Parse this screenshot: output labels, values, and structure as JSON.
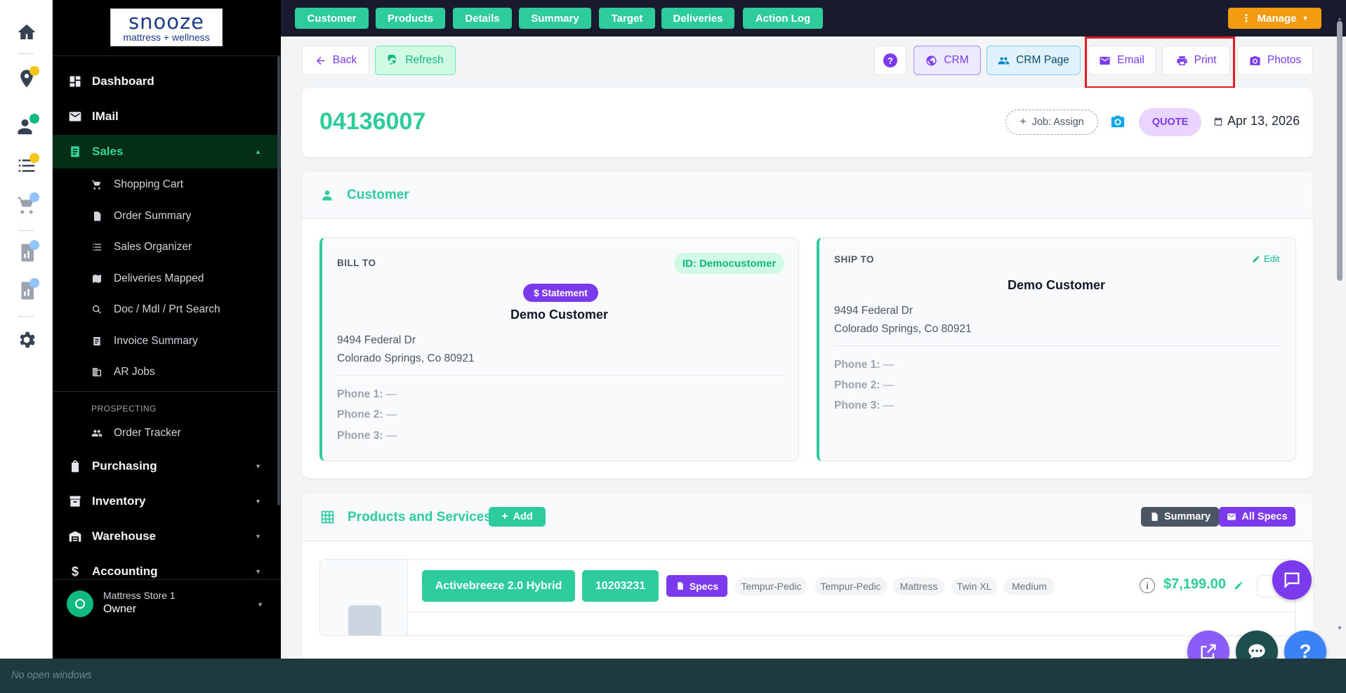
{
  "brand": {
    "logo_main": "snooze",
    "logo_sub": "mattress + wellness"
  },
  "sidebar": {
    "items": [
      {
        "label": "Dashboard"
      },
      {
        "label": "IMail"
      },
      {
        "label": "Sales"
      }
    ],
    "sales_sub": [
      {
        "label": "Shopping Cart"
      },
      {
        "label": "Order Summary"
      },
      {
        "label": "Sales Organizer"
      },
      {
        "label": "Deliveries Mapped"
      },
      {
        "label": "Doc / Mdl / Prt Search"
      },
      {
        "label": "Invoice Summary"
      },
      {
        "label": "AR Jobs"
      }
    ],
    "section_prospecting": "PROSPECTING",
    "prospecting_sub": [
      {
        "label": "Order Tracker"
      }
    ],
    "lower_items": [
      {
        "label": "Purchasing"
      },
      {
        "label": "Inventory"
      },
      {
        "label": "Warehouse"
      },
      {
        "label": "Accounting"
      }
    ],
    "user": {
      "store": "Mattress Store 1",
      "role": "Owner"
    }
  },
  "topbar": {
    "tabs": [
      "Customer",
      "Products",
      "Details",
      "Summary",
      "Target",
      "Deliveries",
      "Action Log"
    ],
    "manage_label": "Manage"
  },
  "toolbar": {
    "back": "Back",
    "refresh": "Refresh",
    "help": "?",
    "crm": "CRM",
    "crm_page": "CRM Page",
    "email": "Email",
    "print": "Print",
    "photos": "Photos"
  },
  "order": {
    "number": "04136007",
    "job_assign": "Job: Assign",
    "status": "QUOTE",
    "date": "Apr 13, 2026"
  },
  "customer_section": {
    "title": "Customer",
    "bill_to": {
      "label": "BILL TO",
      "id": "ID: Democustomer",
      "statement": "$ Statement",
      "name": "Demo Customer",
      "address1": "9494 Federal Dr",
      "address2": "Colorado Springs, Co 80921",
      "phones": [
        {
          "label": "Phone 1:",
          "value": "—"
        },
        {
          "label": "Phone 2:",
          "value": "—"
        },
        {
          "label": "Phone 3:",
          "value": "—"
        }
      ]
    },
    "ship_to": {
      "label": "SHIP TO",
      "edit": "Edit",
      "name": "Demo Customer",
      "address1": "9494 Federal Dr",
      "address2": "Colorado Springs, Co 80921",
      "phones": [
        {
          "label": "Phone 1:",
          "value": "—"
        },
        {
          "label": "Phone 2:",
          "value": "—"
        },
        {
          "label": "Phone 3:",
          "value": "—"
        }
      ]
    }
  },
  "products_section": {
    "title": "Products and Services",
    "add": "Add",
    "summary": "Summary",
    "all_specs": "All Specs",
    "items": [
      {
        "name": "Activebreeze 2.0 Hybrid",
        "sku": "10203231",
        "specs": "Specs",
        "tags": [
          "Tempur-Pedic",
          "Tempur-Pedic",
          "Mattress",
          "Twin XL",
          "Medium"
        ],
        "price": "$7,199.00"
      }
    ]
  },
  "taskbar": {
    "text": "No open windows"
  },
  "colors": {
    "accent": "#2ecc9a",
    "purple": "#7c3aed",
    "manage": "#f39c12",
    "highlight": "#e11d24"
  }
}
